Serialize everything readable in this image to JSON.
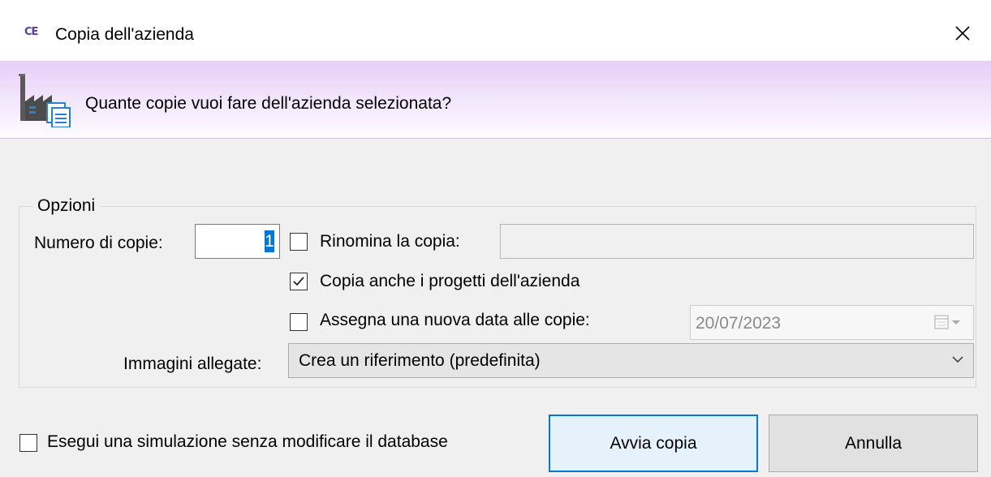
{
  "window": {
    "title": "Copia dell'azienda",
    "app_icon_text": "CE"
  },
  "banner": {
    "question": "Quante copie vuoi fare dell'azienda selezionata?"
  },
  "options": {
    "group_title": "Opzioni",
    "copies_label": "Numero di copie:",
    "copies_value": "1",
    "rename": {
      "label": "Rinomina la copia:",
      "checked": false,
      "value": ""
    },
    "copy_projects": {
      "label": "Copia anche i progetti dell'azienda",
      "checked": true
    },
    "new_date": {
      "label": "Assegna una nuova data alle copie:",
      "checked": false,
      "date_value": "20/07/2023"
    },
    "images_label": "Immagini allegate:",
    "images_selected": "Crea un riferimento (predefinita)"
  },
  "footer": {
    "simulate": {
      "label": "Esegui una simulazione senza modificare il database",
      "checked": false
    },
    "start_button": "Avvia copia",
    "cancel_button": "Annulla"
  },
  "colors": {
    "accent": "#0078d7",
    "banner_top": "#e7cef8",
    "app_icon": "#5a3d9a"
  }
}
